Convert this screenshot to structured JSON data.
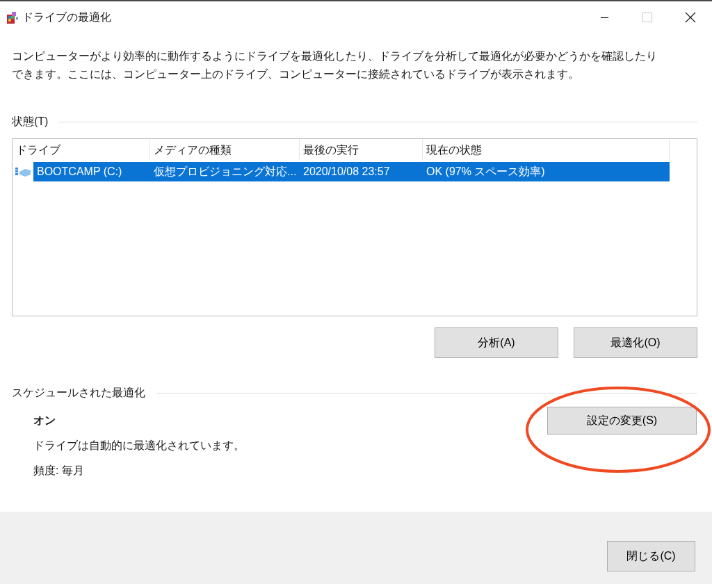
{
  "window": {
    "title": "ドライブの最適化"
  },
  "description": "コンピューターがより効率的に動作するようにドライブを最適化したり、ドライブを分析して最適化が必要かどうかを確認したりできます。ここには、コンピューター上のドライブ、コンピューターに接続されているドライブが表示されます。",
  "status_section": {
    "label": "状態(T)"
  },
  "table": {
    "columns": [
      "ドライブ",
      "メディアの種類",
      "最後の実行",
      "現在の状態"
    ],
    "rows": [
      {
        "selected": true,
        "cells": [
          "BOOTCAMP (C:)",
          "仮想プロビジョニング対応...",
          "2020/10/08 23:57",
          "OK (97% スペース効率)"
        ]
      }
    ]
  },
  "actions": [
    "分析(A)",
    "最適化(O)"
  ],
  "schedule": {
    "label": "スケジュールされた最適化",
    "state": "オン",
    "description": "ドライブは自動的に最適化されています。",
    "frequency": "頻度: 毎月",
    "button": "設定の変更(S)"
  },
  "footer": {
    "button": "閉じる(C)"
  }
}
